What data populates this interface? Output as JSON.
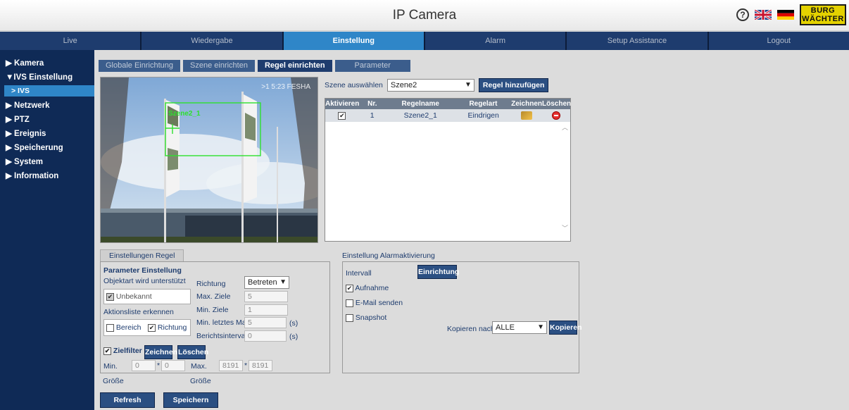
{
  "header": {
    "title": "IP Camera",
    "logo_text": "BURG WÄCHTER"
  },
  "colors": {
    "nav_bg": "#1e3c6e",
    "nav_active": "#2f86c8",
    "sidebar_bg": "#0f2a56",
    "button": "#2b4f82",
    "rule_line": "#2ee02e"
  },
  "nav": [
    "Live",
    "Wiedergabe",
    "Einstellung",
    "Alarm",
    "Setup Assistance",
    "Logout"
  ],
  "sidebar": {
    "items": [
      "▶ Kamera",
      "▼IVS Einstellung",
      "> IVS",
      "▶ Netzwerk",
      "▶ PTZ",
      "▶ Ereignis",
      "▶ Speicherung",
      "▶ System",
      "▶ Information"
    ]
  },
  "tabs": [
    "Globale Einrichtung",
    "Szene einrichten",
    "Regel einrichten",
    "Parameter"
  ],
  "video": {
    "osd_text": ">1 5:23 FESHA",
    "rule_label": "Szene2_1"
  },
  "scene": {
    "label": "Szene auswählen",
    "value": "Szene2",
    "add_button": "Regel hinzufügen"
  },
  "rules_table": {
    "headers": [
      "Aktivieren",
      "Nr.",
      "Regelname",
      "Regelart",
      "Zeichnen",
      "Löschen"
    ],
    "rows": [
      {
        "nr": "1",
        "name": "Szene2_1",
        "type": "Eindrigen",
        "checked": "✔"
      }
    ]
  },
  "rule_settings": {
    "tab": "Einstellungen Regel",
    "heading": "Parameter Einstellung",
    "object_type_label": "Objektart wird unterstützt",
    "object_type_value": "Unbekannt",
    "action_label": "Aktionsliste erkennen",
    "action_area": "Bereich",
    "action_direction": "Richtung",
    "direction_label": "Richtung",
    "direction_value": "Betreten",
    "max_targets_label": "Max. Ziele",
    "max_targets_value": "5",
    "min_targets_label": "Min. Ziele",
    "min_targets_value": "1",
    "min_last_label": "Min. letztes Mal",
    "min_last_value": "5",
    "report_interval_label": "Berichtsintervall",
    "report_interval_value": "0",
    "unit_s": "(s)",
    "target_filter": "Zielfilter",
    "draw_button": "Zeichnen",
    "delete_button": "Löschen",
    "min_label": "Min.",
    "min_w": "0",
    "min_h": "0",
    "max_label": "Max.",
    "max_w": "8191",
    "max_h": "8191",
    "times": "*",
    "size_label": "Größe"
  },
  "alarm_settings": {
    "tab": "Einstellung Alarmaktivierung",
    "interval_label": "Intervall",
    "setup_button": "Einrichtung",
    "record": "Aufnahme",
    "email": "E-Mail senden",
    "snapshot": "Snapshot",
    "copy_label": "Kopieren nach",
    "copy_value": "ALLE",
    "copy_button": "Kopieren"
  },
  "footer": {
    "refresh": "Refresh",
    "save": "Speichern"
  }
}
